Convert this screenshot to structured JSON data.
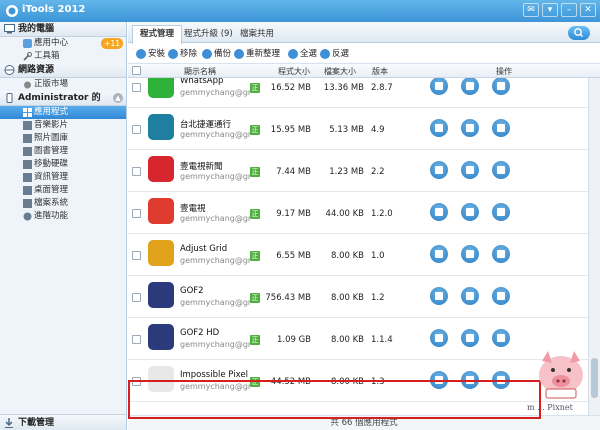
{
  "window": {
    "title": "iTools 2012"
  },
  "sidebar": {
    "sections": [
      {
        "title": "我的電腦",
        "items": [
          {
            "label": "應用中心",
            "badge": "+11"
          },
          {
            "label": "工具箱"
          }
        ]
      },
      {
        "title": "網路資源",
        "items": [
          {
            "label": "正版市場"
          }
        ]
      },
      {
        "title": "Administrator 的 iPho...",
        "items": [
          {
            "label": "應用程式",
            "active": true
          },
          {
            "label": "音樂影片"
          },
          {
            "label": "照片圖庫"
          },
          {
            "label": "圖書管理"
          },
          {
            "label": "移動硬碟"
          },
          {
            "label": "資訊管理"
          },
          {
            "label": "桌面管理"
          },
          {
            "label": "檔案系統"
          },
          {
            "label": "進階功能"
          }
        ]
      }
    ],
    "footer": "下載管理"
  },
  "tabs": [
    "程式管理",
    "程式升級 (9)",
    "檔案共用"
  ],
  "toolbar": [
    "安裝",
    "移除",
    "備份",
    "重新整理",
    "全選",
    "反選"
  ],
  "columns": {
    "name": "顯示名稱",
    "size": "程式大小",
    "docs": "檔案大小",
    "version": "版本",
    "actions": "操作"
  },
  "apps": [
    {
      "name": "WhatsApp",
      "author": "gemmychang@gm...",
      "size": "16.52 MB",
      "docs": "13.36 MB",
      "version": "2.8.7",
      "icon_color": "#2fb23a"
    },
    {
      "name": "台北捷運通行",
      "author": "gemmychang@gm...",
      "size": "15.95 MB",
      "docs": "5.13 MB",
      "version": "4.9",
      "icon_color": "#1f7fa0"
    },
    {
      "name": "壹電視新聞",
      "author": "gemmychang@gm...",
      "size": "7.44 MB",
      "docs": "1.23 MB",
      "version": "2.2",
      "icon_color": "#d8262e"
    },
    {
      "name": "壹電視",
      "author": "gemmychang@gm...",
      "size": "9.17 MB",
      "docs": "44.00 KB",
      "version": "1.2.0",
      "icon_color": "#e03b2f"
    },
    {
      "name": "Adjust Grid",
      "author": "gemmychang@gm...",
      "size": "6.55 MB",
      "docs": "8.00 KB",
      "version": "1.0",
      "icon_color": "#e0a21a"
    },
    {
      "name": "GOF2",
      "author": "gemmychang@gm...",
      "size": "756.43 MB",
      "docs": "8.00 KB",
      "version": "1.2",
      "icon_color": "#2b3a7a"
    },
    {
      "name": "GOF2 HD",
      "author": "gemmychang@gm...",
      "size": "1.09 GB",
      "docs": "8.00 KB",
      "version": "1.1.4",
      "icon_color": "#2b3a7a"
    },
    {
      "name": "Impossible Pixel",
      "author": "gemmychang@gm...",
      "size": "44.52 MB",
      "docs": "8.00 KB",
      "version": "1.3",
      "icon_color": "#e8e8e8"
    }
  ],
  "status": "共 66 個應用程式",
  "watermark": "m ... Pixnet"
}
